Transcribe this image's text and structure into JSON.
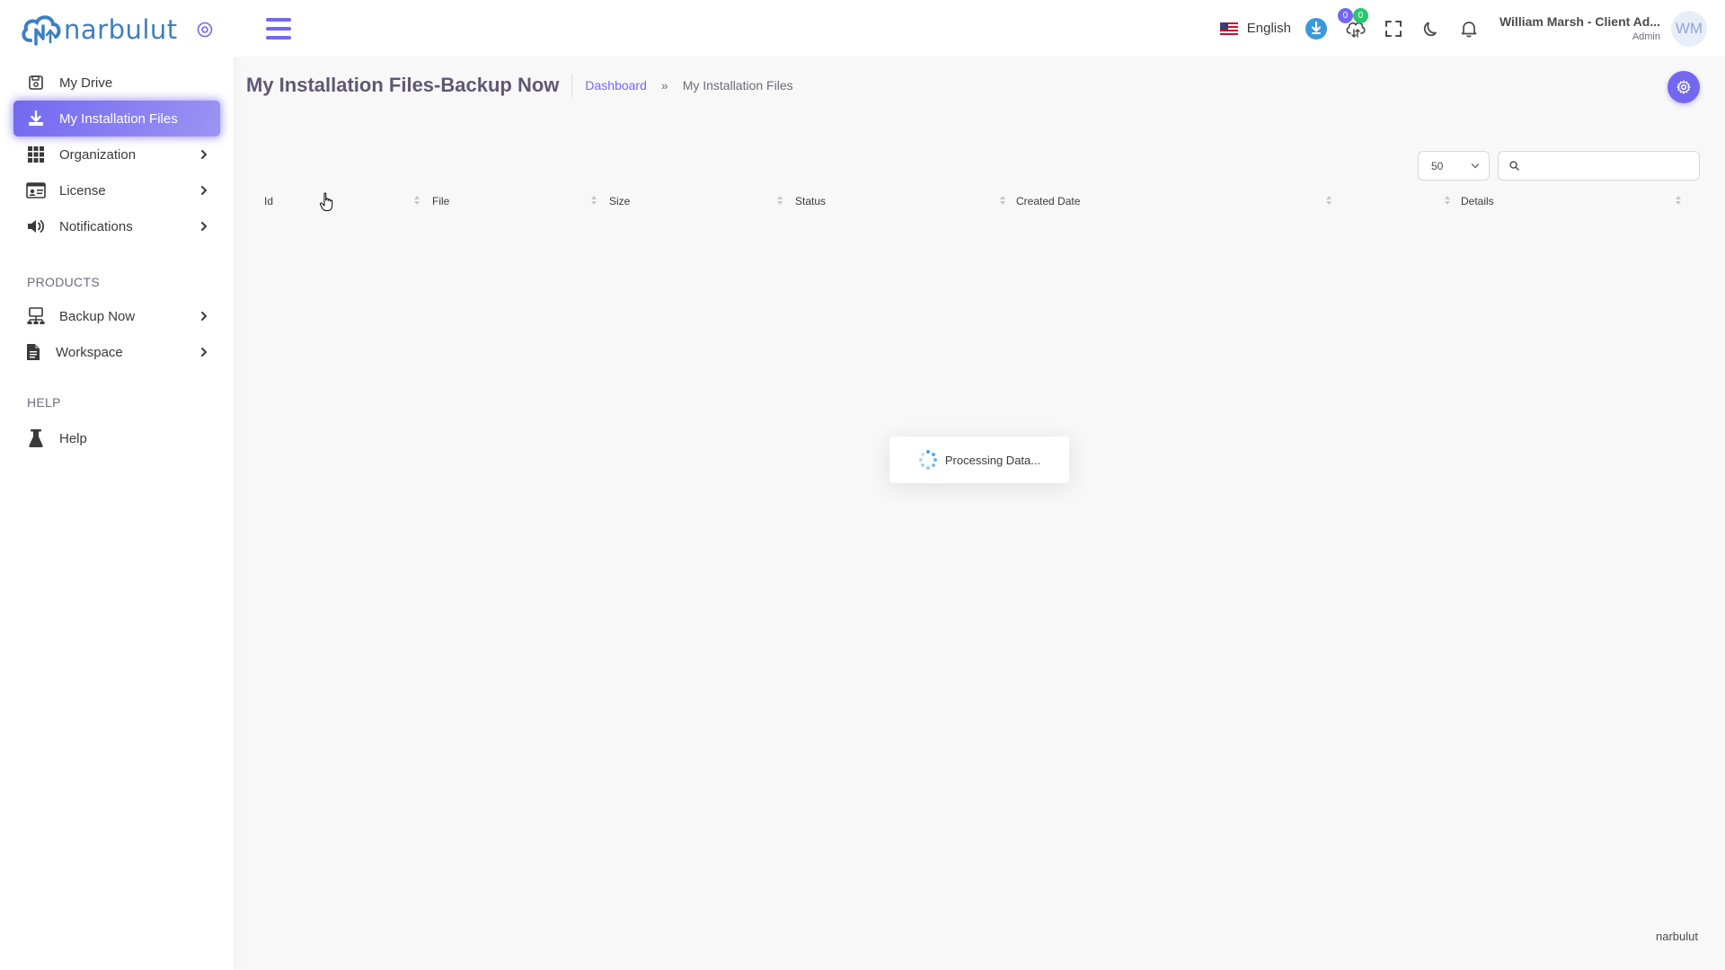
{
  "brand": {
    "name": "narbulut"
  },
  "sidebar": {
    "items": [
      {
        "label": "My Drive",
        "icon": "hard-drive-icon"
      },
      {
        "label": "My Installation Files",
        "icon": "download-icon",
        "active": true
      },
      {
        "label": "Organization",
        "icon": "grid-icon",
        "has_children": true
      },
      {
        "label": "License",
        "icon": "id-card-icon",
        "has_children": true
      },
      {
        "label": "Notifications",
        "icon": "megaphone-icon",
        "has_children": true
      }
    ],
    "products_header": "PRODUCTS",
    "products": [
      {
        "label": "Backup Now",
        "icon": "network-icon",
        "has_children": true
      },
      {
        "label": "Workspace",
        "icon": "file-icon",
        "has_children": true
      }
    ],
    "help_header": "HELP",
    "help": [
      {
        "label": "Help",
        "icon": "flask-icon"
      }
    ]
  },
  "navbar": {
    "language": "English",
    "badge_left": "0",
    "badge_right": "0",
    "user_name": "William Marsh - Client Ad...",
    "user_role": "Admin",
    "avatar_initials": "WM"
  },
  "page": {
    "title": "My Installation Files-Backup Now",
    "breadcrumb_home": "Dashboard",
    "breadcrumb_sep": "»",
    "breadcrumb_current": "My Installation Files"
  },
  "table": {
    "page_size": "50",
    "search_value": "",
    "columns": [
      "Id",
      "File",
      "Size",
      "Status",
      "Created Date",
      "",
      "Details"
    ]
  },
  "processing_text": "Processing Data...",
  "footer": "narbulut",
  "colors": {
    "primary": "#7367f0",
    "success": "#28c76f",
    "brand": "#3b7fc4"
  }
}
